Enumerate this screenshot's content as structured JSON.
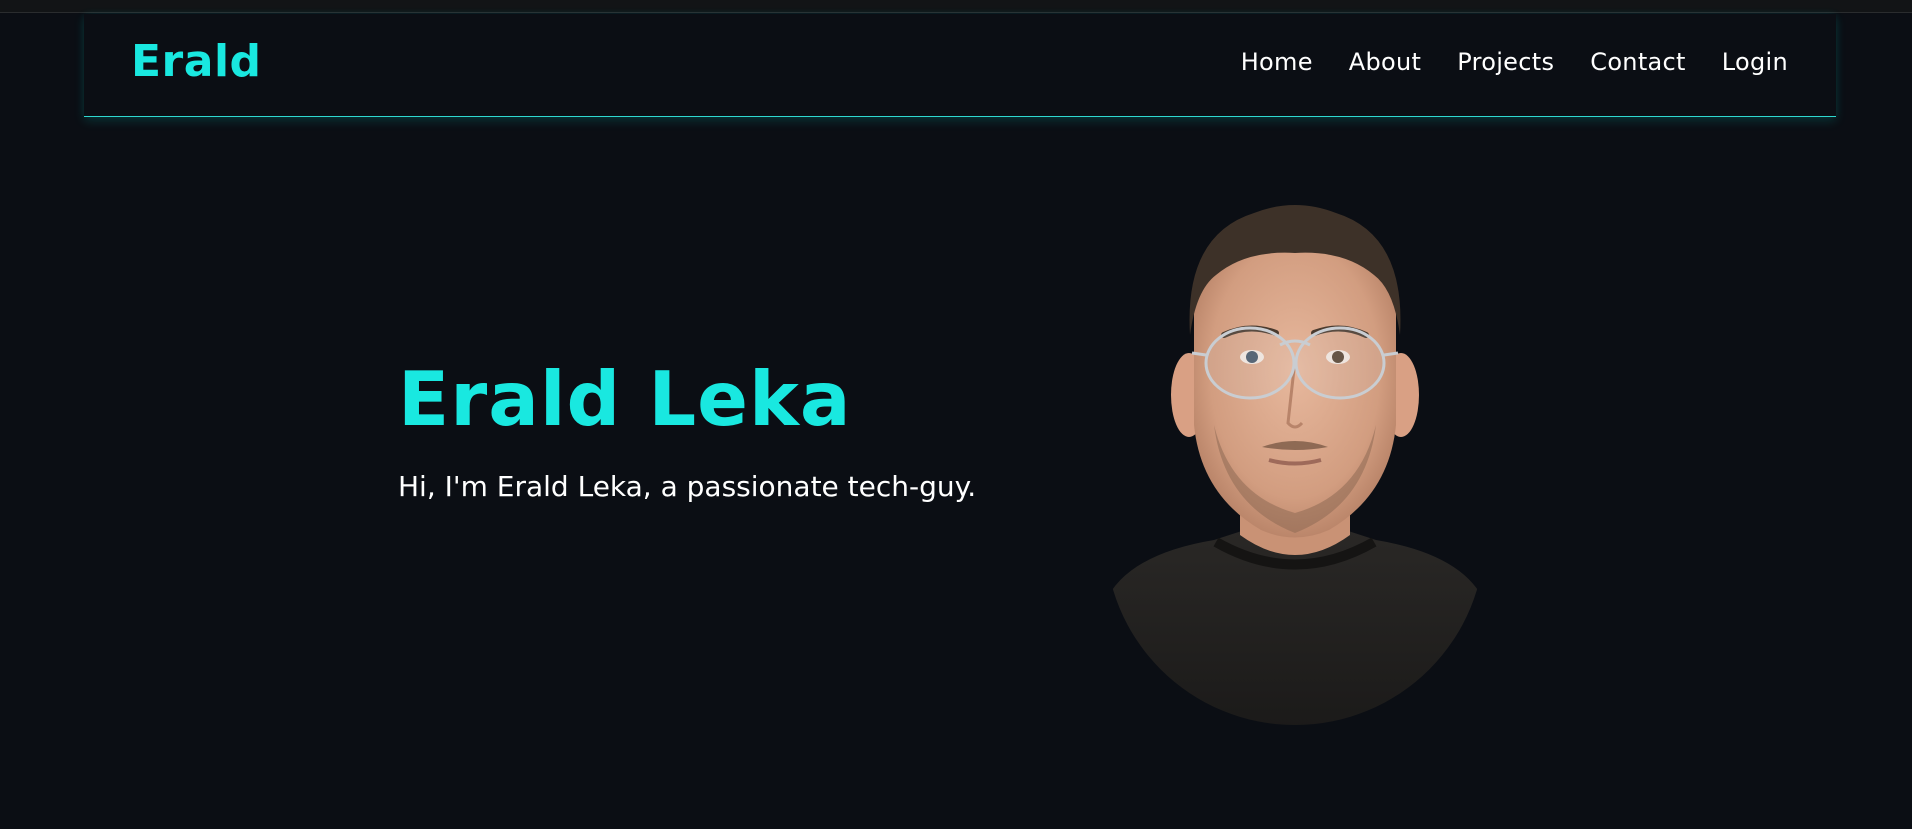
{
  "nav": {
    "logo": "Erald",
    "links": [
      "Home",
      "About",
      "Projects",
      "Contact",
      "Login"
    ]
  },
  "hero": {
    "title": "Erald Leka",
    "subtitle": "Hi, I'm Erald Leka, a passionate tech-guy."
  },
  "colors": {
    "accent": "#19e8e0",
    "background": "#0b0e14",
    "text": "#ffffff"
  }
}
